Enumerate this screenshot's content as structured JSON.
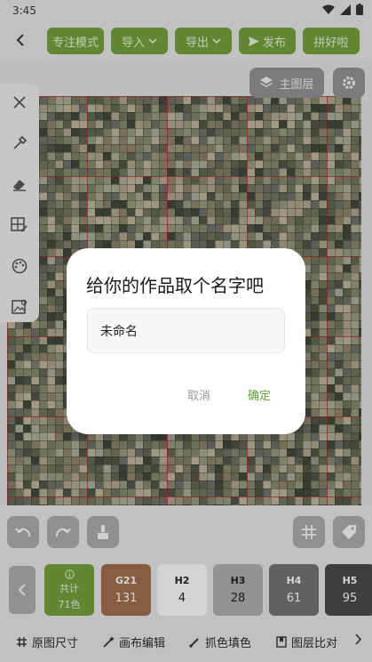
{
  "status_bar": {
    "time": "3:45"
  },
  "toolbar": {
    "focus_mode": "专注模式",
    "import": "导入",
    "export": "导出",
    "publish": "发布",
    "pindou": "拼好啦"
  },
  "canvas": {
    "layer_button": "主图层"
  },
  "palette": {
    "summary": {
      "label": "共计",
      "count": "71色"
    },
    "swatches": [
      {
        "code": "G21",
        "count": "131",
        "color": "#9a6a4a"
      },
      {
        "code": "H2",
        "count": "4",
        "color": "#f2f2f2"
      },
      {
        "code": "H3",
        "count": "28",
        "color": "#a7a7a7"
      },
      {
        "code": "H4",
        "count": "61",
        "color": "#6f6f6f"
      },
      {
        "code": "H5",
        "count": "95",
        "color": "#474747"
      }
    ]
  },
  "bottom_tabs": [
    "原图尺寸",
    "画布编辑",
    "抓色填色",
    "图层比对"
  ],
  "dialog": {
    "title": "给你的作品取个名字吧",
    "input_value": "未命名",
    "cancel": "取消",
    "confirm": "确定"
  },
  "colors": {
    "accent_green": "#6f9a3c",
    "confirm_green": "#5a9e2f"
  }
}
